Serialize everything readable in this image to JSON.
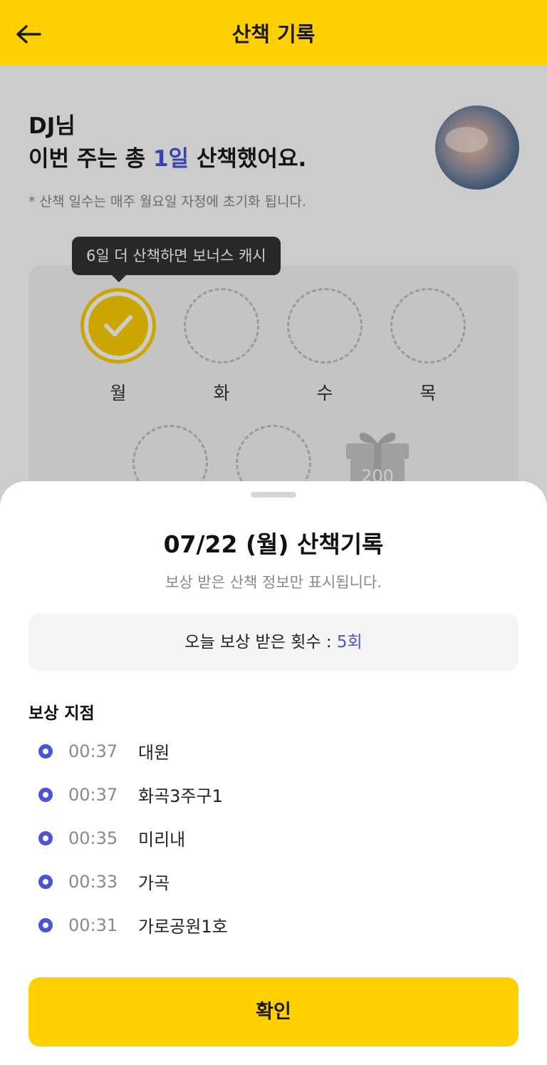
{
  "header": {
    "title": "산책 기록"
  },
  "summary": {
    "greeting_name": "DJ님",
    "greeting_prefix": "이번 주는 총 ",
    "days_count": "1일",
    "greeting_suffix": " 산책했어요.",
    "notice": "* 산책 일수는 매주 월요일 자정에 초기화 됩니다."
  },
  "bonus_tooltip": "6일 더 산책하면 보너스 캐시",
  "week": {
    "days": [
      {
        "label": "월",
        "done": true
      },
      {
        "label": "화",
        "done": false
      },
      {
        "label": "수",
        "done": false
      },
      {
        "label": "목",
        "done": false
      }
    ],
    "gift_amount": "200"
  },
  "sheet": {
    "title": "07/22 (월) 산책기록",
    "subtitle": "보상 받은 산책 정보만 표시됩니다.",
    "count_label": "오늘 보상 받은 횟수 : ",
    "count_value": "5회",
    "section_title": "보상 지점",
    "rewards": [
      {
        "time": "00:37",
        "place": "대원"
      },
      {
        "time": "00:37",
        "place": "화곡3주구1"
      },
      {
        "time": "00:35",
        "place": "미리내"
      },
      {
        "time": "00:33",
        "place": "가곡"
      },
      {
        "time": "00:31",
        "place": "가로공원1호"
      }
    ],
    "confirm_label": "확인"
  },
  "colors": {
    "brand_yellow": "#FED000",
    "accent_blue": "#4c53d6"
  }
}
